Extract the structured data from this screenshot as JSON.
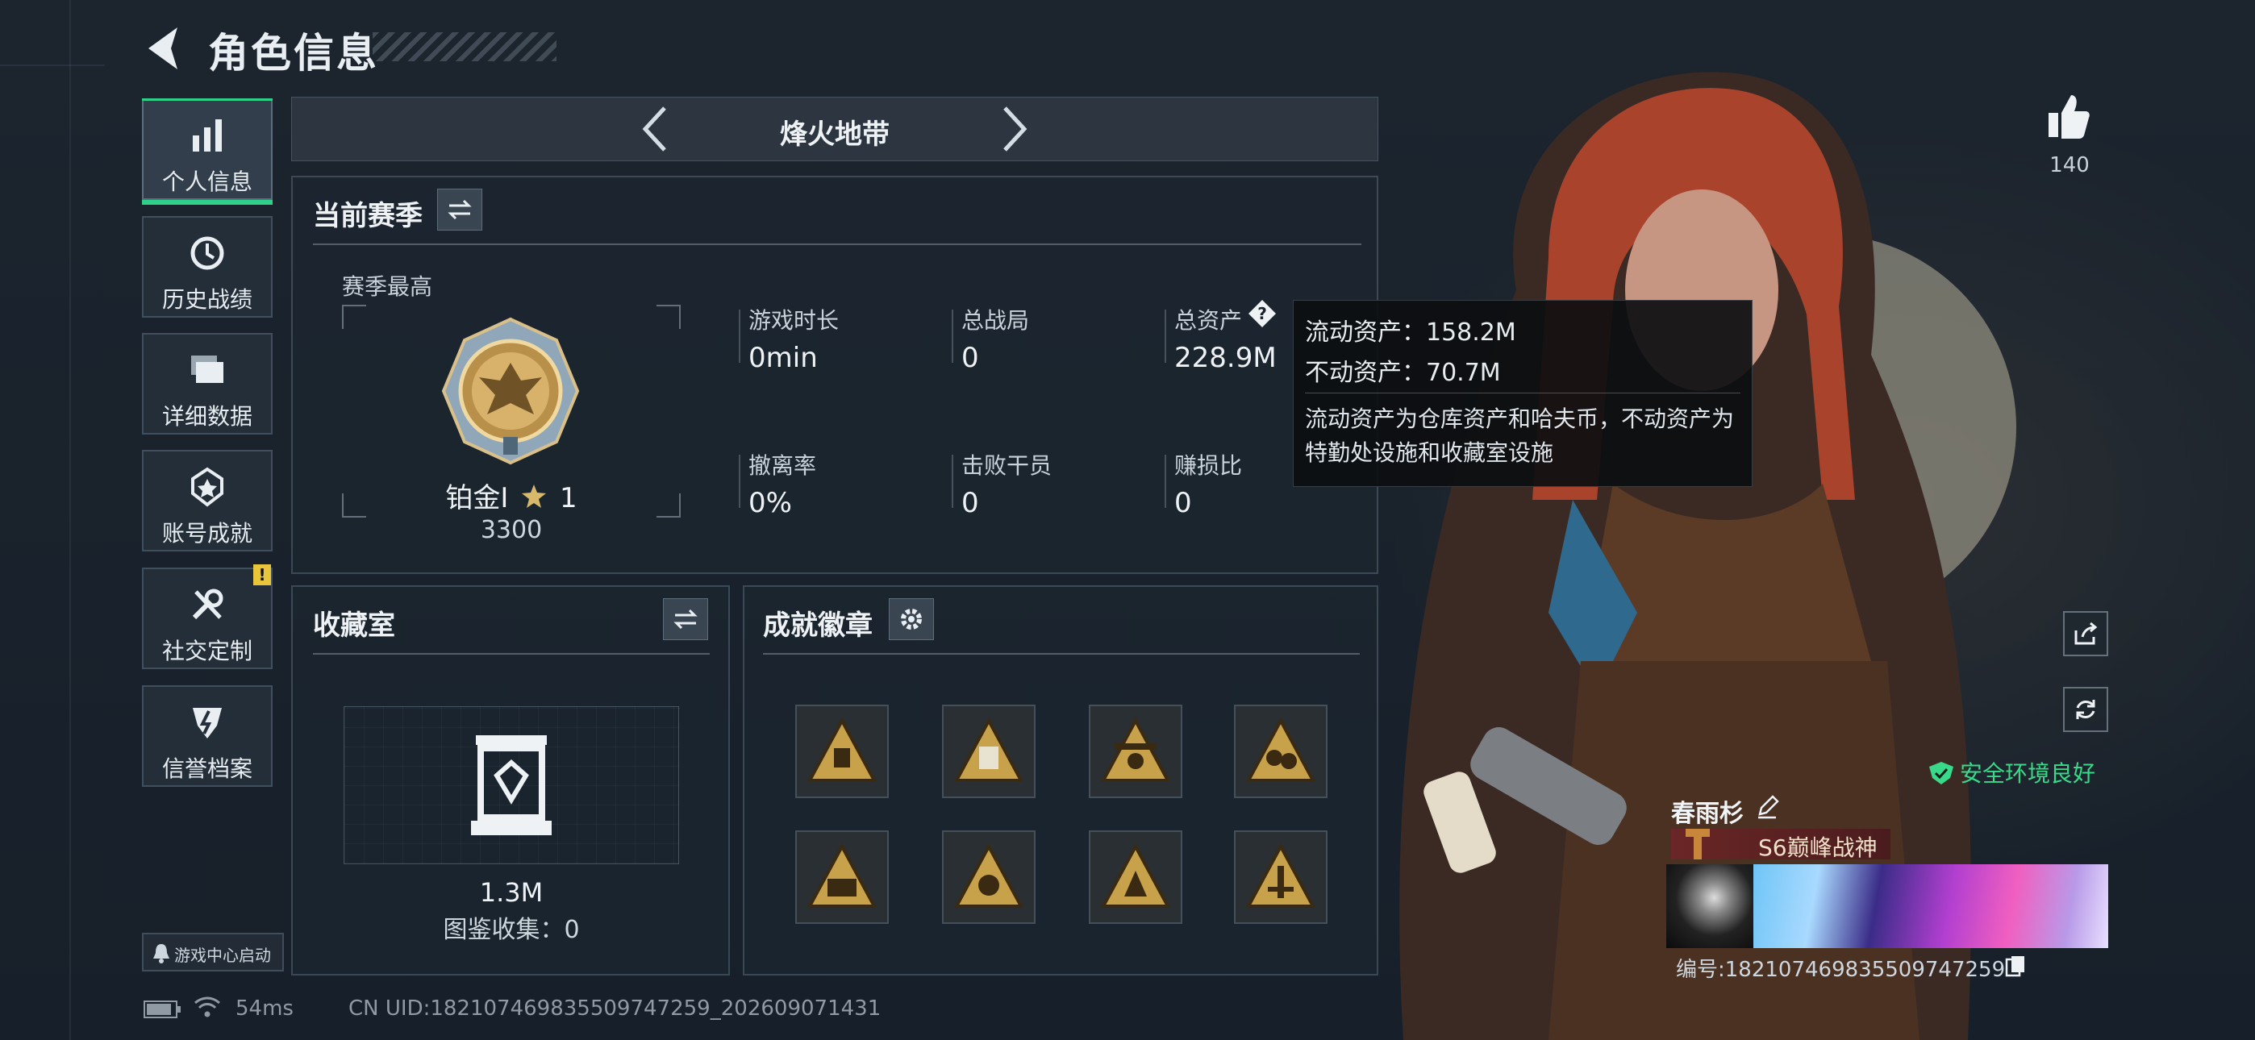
{
  "header": {
    "title": "角色信息"
  },
  "sidebar": {
    "items": [
      {
        "label": "个人信息",
        "icon": "bar-chart-icon",
        "active": true
      },
      {
        "label": "历史战绩",
        "icon": "history-icon"
      },
      {
        "label": "详细数据",
        "icon": "stack-icon"
      },
      {
        "label": "账号成就",
        "icon": "achievement-icon"
      },
      {
        "label": "社交定制",
        "icon": "wrench-icon",
        "badge": "!"
      },
      {
        "label": "信誉档案",
        "icon": "credit-icon"
      }
    ],
    "game_center": "游戏中心启动"
  },
  "zone_nav": {
    "name": "烽火地带"
  },
  "current_season": {
    "title": "当前赛季",
    "season_best_label": "赛季最高",
    "rank_name": "铂金I",
    "rank_star": "1",
    "rank_points": "3300",
    "stats": [
      {
        "label": "游戏时长",
        "value": "0min"
      },
      {
        "label": "总战局",
        "value": "0"
      },
      {
        "label": "总资产",
        "value": "228.9M"
      },
      {
        "label": "撤离率",
        "value": "0%"
      },
      {
        "label": "击败干员",
        "value": "0"
      },
      {
        "label": "赚损比",
        "value": "0"
      }
    ]
  },
  "asset_tooltip": {
    "liquid": "流动资产：158.2M",
    "fixed": "不动资产：70.7M",
    "note": "流动资产为仓库资产和哈夫币，不动资产为特勤处设施和收藏室设施"
  },
  "collection": {
    "title": "收藏室",
    "value": "1.3M",
    "catalog": "图鉴收集：0"
  },
  "achievements": {
    "title": "成就徽章",
    "badges": [
      "badge-1",
      "badge-2",
      "badge-3",
      "badge-4",
      "badge-5",
      "badge-6",
      "badge-7",
      "badge-8"
    ]
  },
  "profile": {
    "likes": "140",
    "env_status": "安全环境良好",
    "player_name": "春雨杉",
    "player_title": "S6巅峰战神",
    "player_id": "编号:182107469835509747259"
  },
  "status_bar": {
    "ping": "54ms",
    "uid": "CN UID:182107469835509747259_202609071431"
  },
  "colors": {
    "accent": "#2fd08a",
    "safe": "#39d98a",
    "gold": "#c8a24a"
  }
}
